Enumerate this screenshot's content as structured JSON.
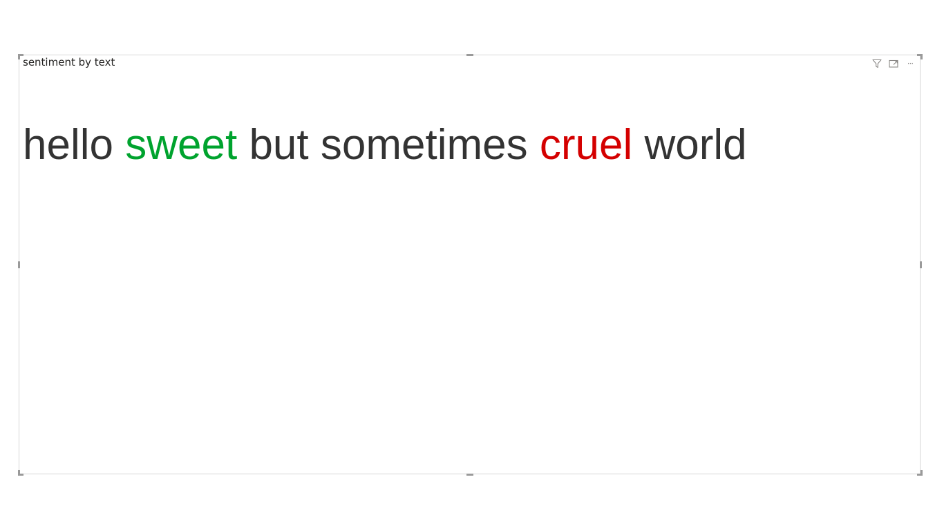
{
  "visual": {
    "title": "sentiment by text",
    "header_icons": [
      "filter-icon",
      "focus-mode-icon",
      "more-options-icon"
    ],
    "more_options_glyph": "···"
  },
  "sentiment": {
    "words": [
      {
        "text": "hello",
        "color": "#333333"
      },
      {
        "text": "sweet",
        "color": "#00a32e"
      },
      {
        "text": "but",
        "color": "#333333"
      },
      {
        "text": "sometimes",
        "color": "#333333"
      },
      {
        "text": "cruel",
        "color": "#d40000"
      },
      {
        "text": "world",
        "color": "#333333"
      }
    ]
  }
}
